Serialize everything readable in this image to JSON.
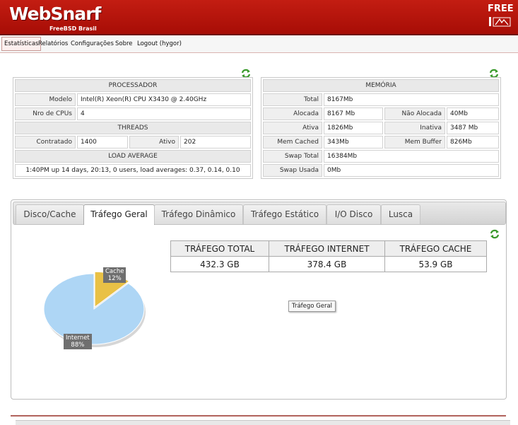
{
  "app": {
    "logo": "WebSnarf",
    "logo_sub": "FreeBSD Brasil",
    "badge": "FREE"
  },
  "menu": [
    "Estatísticas",
    "Relatórios",
    "Configurações",
    "Sobre",
    "Logout (hygor)"
  ],
  "processador": {
    "title": "PROCESSADOR",
    "modelo_label": "Modelo",
    "modelo": "Intel(R) Xeon(R) CPU X3430 @ 2.40GHz",
    "cpus_label": "Nro de CPUs",
    "cpus": "4",
    "threads_title": "THREADS",
    "contratado_label": "Contratado",
    "contratado": "1400",
    "ativo_label": "Ativo",
    "ativo": "202",
    "load_title": "LOAD AVERAGE",
    "load": "1:40PM up 14 days, 20:13, 0 users, load averages: 0.37, 0.14, 0.10"
  },
  "memoria": {
    "title": "MEMÓRIA",
    "total_label": "Total",
    "total": "8167Mb",
    "alocada_label": "Alocada",
    "alocada": "8167 Mb",
    "nao_alocada_label": "Não Alocada",
    "nao_alocada": "40Mb",
    "ativa_label": "Ativa",
    "ativa": "1826Mb",
    "inativa_label": "Inativa",
    "inativa": "3487 Mb",
    "cached_label": "Mem Cached",
    "cached": "343Mb",
    "buffer_label": "Mem Buffer",
    "buffer": "826Mb",
    "swap_total_label": "Swap Total",
    "swap_total": "16384Mb",
    "swap_usada_label": "Swap Usada",
    "swap_usada": "0Mb"
  },
  "tabs": [
    "Disco/Cache",
    "Tráfego Geral",
    "Tráfego Dinâmico",
    "Tráfego Estático",
    "I/O Disco",
    "Lusca"
  ],
  "active_tab": "Tráfego Geral",
  "traffic": {
    "headers": [
      "TRÁFEGO TOTAL",
      "TRÁFEGO INTERNET",
      "TRÁFEGO CACHE"
    ],
    "values": [
      "432.3 GB",
      "378.4 GB",
      "53.9 GB"
    ],
    "tooltip": "Tráfego Geral"
  },
  "icons": {
    "refresh": "refresh-icon",
    "badge": "freebsd-badge-icon"
  },
  "colors": {
    "header": "#b3140b",
    "internet": "#aed6f5",
    "cache": "#e9c146"
  },
  "chart_data": {
    "type": "pie",
    "labels": [
      "Internet",
      "Cache"
    ],
    "values": [
      88,
      12
    ],
    "value_labels": [
      "88%",
      "12%"
    ],
    "colors": [
      "#aed6f5",
      "#e9c146"
    ]
  }
}
